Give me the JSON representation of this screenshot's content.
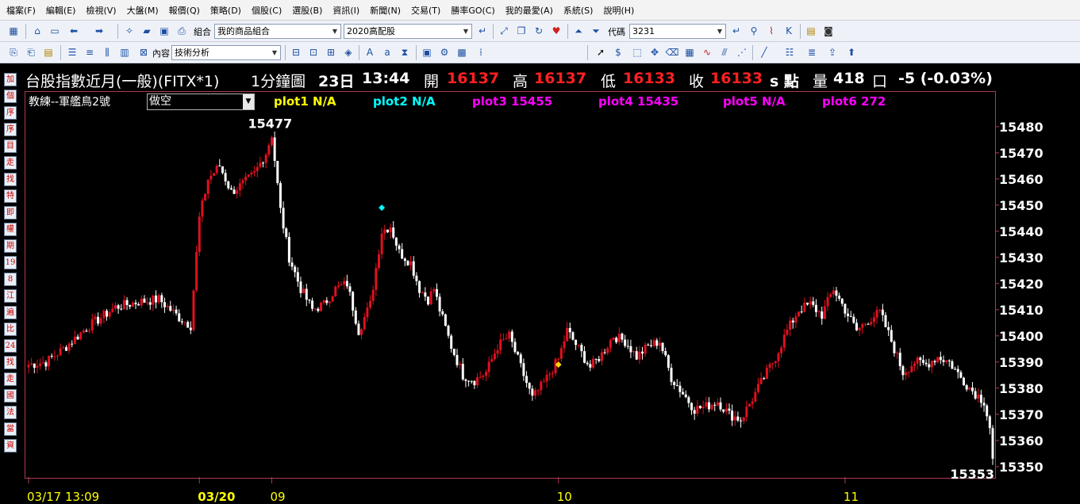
{
  "menu": [
    "檔案(F)",
    "編輯(E)",
    "檢視(V)",
    "大盤(M)",
    "報價(Q)",
    "策略(D)",
    "個股(C)",
    "選股(B)",
    "資訊(I)",
    "新聞(N)",
    "交易(T)",
    "勝率GO(C)",
    "我的最愛(A)",
    "系統(S)",
    "說明(H)"
  ],
  "toolbar1": {
    "group_label": "組合",
    "group_value": "我的商品組合",
    "preset_value": "2020高配股",
    "code_label": "代碼",
    "code_value": "3231"
  },
  "toolbar2": {
    "content_label": "內容",
    "content_value": "技術分析"
  },
  "sidebar": [
    "加",
    "個",
    "序",
    "序",
    "目",
    "走",
    "找",
    "特",
    "即",
    "權",
    "期",
    "19",
    "8",
    "江",
    "遍",
    "比",
    "24",
    "找",
    "走",
    "國",
    "法",
    "當",
    "資"
  ],
  "quote": {
    "symbol": "台股指數近月(一般)(FITX*1)",
    "period": "1分鐘圖",
    "date": "23日",
    "time": "13:44",
    "open_label": "開",
    "open": "16137",
    "high_label": "高",
    "high": "16137",
    "low_label": "低",
    "low": "16133",
    "close_label": "收",
    "close": "16133",
    "unit": "s 點",
    "volume_label": "量",
    "volume": "418",
    "volume_unit": "口",
    "change": "-5 (-0.03%)"
  },
  "strategy": {
    "name": "教練--軍艦鳥2號",
    "direction": "做空"
  },
  "plots": [
    {
      "label": "plot1 N/A",
      "color": "#ffff00"
    },
    {
      "label": "plot2 N/A",
      "color": "#00ffff"
    },
    {
      "label": "plot3 15455",
      "color": "#ff00ff"
    },
    {
      "label": "plot4 15435",
      "color": "#ff00ff"
    },
    {
      "label": "plot5 N/A",
      "color": "#ff00ff"
    },
    {
      "label": "plot6 272",
      "color": "#ff00ff"
    }
  ],
  "colors": {
    "up_candle": "#e01020",
    "down_candle": "#ffffff",
    "price_red": "#ff2020",
    "frame": "#b03a52",
    "background": "#000000"
  },
  "chart_data": {
    "type": "candlestick",
    "ylim": [
      15346,
      15486
    ],
    "y_ticks": [
      "15480",
      "15470",
      "15460",
      "15450",
      "15440",
      "15430",
      "15420",
      "15410",
      "15400",
      "15390",
      "15380",
      "15370",
      "15360",
      "15350"
    ],
    "x_labels": [
      {
        "text": "03/17 13:09",
        "bar": 0,
        "bold": false
      },
      {
        "text": "03/20",
        "bar": 59,
        "bold": true
      },
      {
        "text": "09",
        "bar": 84,
        "bold": false
      },
      {
        "text": "10",
        "bar": 183,
        "bold": false
      },
      {
        "text": "11",
        "bar": 282,
        "bold": false
      }
    ],
    "annotations": [
      {
        "text": "15477",
        "value": 15477,
        "bar": 84
      },
      {
        "text": "15353",
        "value": 15353,
        "bar": 333
      }
    ],
    "markers": [
      {
        "type": "diamond",
        "color": "#00ffff",
        "bar": 122,
        "value": 15449
      },
      {
        "type": "diamond",
        "color": "#ffd700",
        "bar": 183,
        "value": 15389
      }
    ],
    "anchors": [
      [
        0,
        15389
      ],
      [
        6,
        15390
      ],
      [
        12,
        15395
      ],
      [
        20,
        15403
      ],
      [
        30,
        15411
      ],
      [
        38,
        15413
      ],
      [
        45,
        15414
      ],
      [
        52,
        15407
      ],
      [
        56,
        15404
      ],
      [
        59,
        15445
      ],
      [
        62,
        15460
      ],
      [
        66,
        15465
      ],
      [
        70,
        15455
      ],
      [
        74,
        15458
      ],
      [
        78,
        15462
      ],
      [
        82,
        15470
      ],
      [
        84,
        15477
      ],
      [
        87,
        15448
      ],
      [
        90,
        15430
      ],
      [
        94,
        15418
      ],
      [
        98,
        15410
      ],
      [
        102,
        15412
      ],
      [
        106,
        15418
      ],
      [
        110,
        15420
      ],
      [
        114,
        15402
      ],
      [
        118,
        15412
      ],
      [
        122,
        15440
      ],
      [
        125,
        15442
      ],
      [
        128,
        15432
      ],
      [
        132,
        15428
      ],
      [
        135,
        15418
      ],
      [
        138,
        15414
      ],
      [
        140,
        15418
      ],
      [
        142,
        15410
      ],
      [
        146,
        15396
      ],
      [
        150,
        15385
      ],
      [
        154,
        15383
      ],
      [
        158,
        15386
      ],
      [
        162,
        15396
      ],
      [
        166,
        15400
      ],
      [
        170,
        15388
      ],
      [
        174,
        15376
      ],
      [
        178,
        15382
      ],
      [
        183,
        15391
      ],
      [
        186,
        15402
      ],
      [
        190,
        15395
      ],
      [
        194,
        15388
      ],
      [
        198,
        15393
      ],
      [
        202,
        15400
      ],
      [
        206,
        15398
      ],
      [
        210,
        15392
      ],
      [
        214,
        15396
      ],
      [
        218,
        15398
      ],
      [
        222,
        15384
      ],
      [
        226,
        15378
      ],
      [
        230,
        15372
      ],
      [
        234,
        15373
      ],
      [
        238,
        15375
      ],
      [
        242,
        15370
      ],
      [
        246,
        15368
      ],
      [
        250,
        15376
      ],
      [
        254,
        15384
      ],
      [
        258,
        15392
      ],
      [
        262,
        15402
      ],
      [
        266,
        15410
      ],
      [
        270,
        15412
      ],
      [
        274,
        15408
      ],
      [
        278,
        15418
      ],
      [
        282,
        15410
      ],
      [
        286,
        15402
      ],
      [
        290,
        15406
      ],
      [
        294,
        15409
      ],
      [
        298,
        15398
      ],
      [
        302,
        15386
      ],
      [
        306,
        15390
      ],
      [
        310,
        15389
      ],
      [
        314,
        15392
      ],
      [
        318,
        15390
      ],
      [
        322,
        15384
      ],
      [
        326,
        15379
      ],
      [
        330,
        15375
      ],
      [
        332,
        15365
      ],
      [
        333,
        15353
      ]
    ]
  }
}
